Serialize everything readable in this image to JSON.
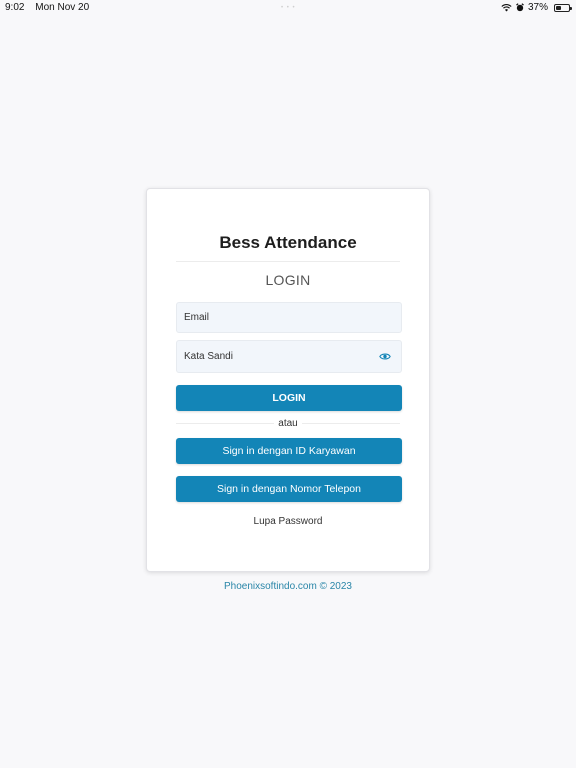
{
  "status_bar": {
    "time": "9:02",
    "date": "Mon Nov 20",
    "battery": "37%"
  },
  "app": {
    "title": "Bess Attendance",
    "section_title": "LOGIN"
  },
  "form": {
    "email_placeholder": "Email",
    "email_value": "",
    "password_placeholder": "Kata Sandi",
    "password_value": "",
    "login_label": "LOGIN",
    "or_text": "atau",
    "id_signin_label": "Sign in dengan ID Karyawan",
    "phone_signin_label": "Sign in dengan Nomor Telepon",
    "forgot_label": "Lupa Password"
  },
  "footer": {
    "text": "Phoenixsoftindo.com © 2023"
  },
  "colors": {
    "primary": "#1385b7",
    "footer_link": "#2a86a8",
    "background": "#f8f8fa"
  },
  "icons": {
    "password_toggle": "eye-icon",
    "wifi": "wifi-icon",
    "alarm": "alarm-icon",
    "battery": "battery-icon"
  }
}
